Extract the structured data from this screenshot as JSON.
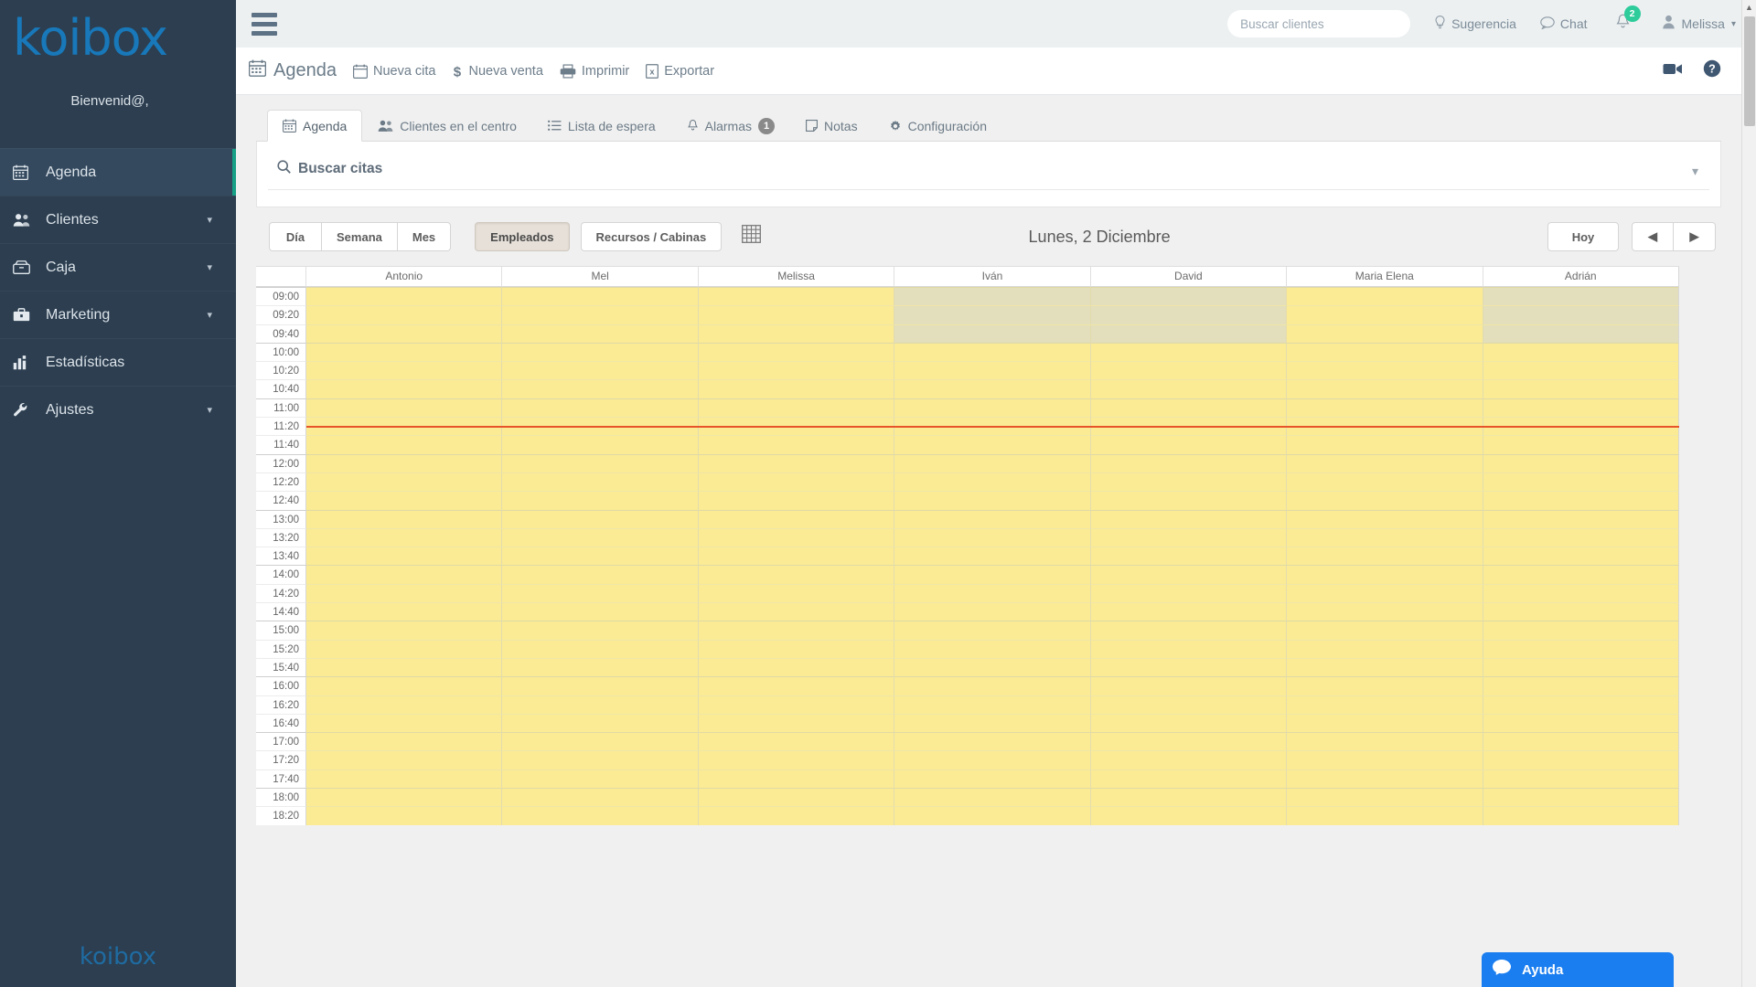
{
  "sidebar": {
    "brand": "koibox",
    "welcome": "Bienvenid@,",
    "footer_brand": "koibox",
    "items": [
      {
        "label": "Agenda",
        "icon": "calendar-icon",
        "caret": "",
        "active": true
      },
      {
        "label": "Clientes",
        "icon": "users-icon",
        "caret": "▾",
        "active": false
      },
      {
        "label": "Caja",
        "icon": "cashbox-icon",
        "caret": "▾",
        "active": false
      },
      {
        "label": "Marketing",
        "icon": "briefcase-icon",
        "caret": "▾",
        "active": false
      },
      {
        "label": "Estadísticas",
        "icon": "bar-chart-icon",
        "caret": "",
        "active": false
      },
      {
        "label": "Ajustes",
        "icon": "wrench-icon",
        "caret": "▾",
        "active": false
      }
    ]
  },
  "topbar": {
    "search_placeholder": "Buscar clientes",
    "search_value": "",
    "suggestion_label": "Sugerencia",
    "chat_label": "Chat",
    "notification_count": "2",
    "user_name": "Melissa"
  },
  "actionbar": {
    "title": "Agenda",
    "links": [
      {
        "label": "Nueva cita",
        "icon": "calendar-plus-icon"
      },
      {
        "label": "Nueva venta",
        "icon": "dollar-icon"
      },
      {
        "label": "Imprimir",
        "icon": "printer-icon"
      },
      {
        "label": "Exportar",
        "icon": "excel-icon"
      }
    ],
    "video_icon": "video-camera-icon",
    "help_icon": "question-circle-icon"
  },
  "tabs": [
    {
      "label": "Agenda",
      "icon": "calendar-icon",
      "badge": "",
      "active": true
    },
    {
      "label": "Clientes en el centro",
      "icon": "users-icon",
      "badge": "",
      "active": false
    },
    {
      "label": "Lista de espera",
      "icon": "list-icon",
      "badge": "",
      "active": false
    },
    {
      "label": "Alarmas",
      "icon": "bell-icon",
      "badge": "1",
      "active": false
    },
    {
      "label": "Notas",
      "icon": "note-icon",
      "badge": "",
      "active": false
    },
    {
      "label": "Configuración",
      "icon": "gear-icon",
      "badge": "",
      "active": false
    }
  ],
  "search_card": {
    "label": "Buscar citas",
    "search_icon": "search-icon",
    "chevron_icon": "chevron-down-icon"
  },
  "calendar_toolbar": {
    "view_buttons": [
      {
        "label": "Día",
        "pressed": false
      },
      {
        "label": "Semana",
        "pressed": false
      },
      {
        "label": "Mes",
        "pressed": false
      }
    ],
    "mode_buttons": [
      {
        "label": "Empleados",
        "pressed": true
      },
      {
        "label": "Recursos / Cabinas",
        "pressed": false
      }
    ],
    "mini_calendar_icon": "calendar-grid-icon",
    "date_title": "Lunes, 2 Diciembre",
    "today_label": "Hoy",
    "prev_icon": "◀",
    "next_icon": "▶"
  },
  "calendar": {
    "columns": [
      "Antonio",
      "Mel",
      "Melissa",
      "Iván",
      "David",
      "Maria Elena",
      "Adrián"
    ],
    "times": [
      "09:00",
      "09:20",
      "09:40",
      "10:00",
      "10:20",
      "10:40",
      "11:00",
      "11:20",
      "11:40",
      "12:00",
      "12:20",
      "12:40",
      "13:00",
      "13:20",
      "13:40",
      "14:00",
      "14:20",
      "14:40",
      "15:00",
      "15:20",
      "15:40",
      "16:00",
      "16:20",
      "16:40",
      "17:00",
      "17:20",
      "17:40",
      "18:00",
      "18:20"
    ],
    "blocked_cells": [
      {
        "row": 0,
        "cols": [
          3,
          4,
          6
        ]
      },
      {
        "row": 1,
        "cols": [
          3,
          4,
          6
        ]
      },
      {
        "row": 2,
        "cols": [
          3,
          4,
          6
        ]
      }
    ],
    "current_time_row": 7,
    "colors": {
      "available": "#faeb94",
      "blocked": "#e3debb",
      "now_line": "#e8542a"
    }
  },
  "ayuda_widget": {
    "label": "Ayuda",
    "icon": "chat-bubble-icon"
  }
}
